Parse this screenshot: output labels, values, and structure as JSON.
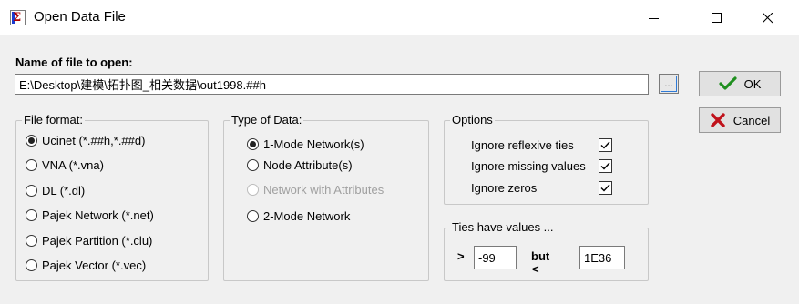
{
  "window": {
    "title": "Open Data File"
  },
  "file": {
    "label": "Name of file to open:",
    "path": "E:\\Desktop\\建模\\拓扑图_相关数据\\out1998.##h",
    "browse_label": "..."
  },
  "buttons": {
    "ok": "OK",
    "cancel": "Cancel"
  },
  "file_format": {
    "title": "File format:",
    "options": [
      "Ucinet (*.##h,*.##d)",
      "VNA (*.vna)",
      "DL (*.dl)",
      "Pajek Network (*.net)",
      "Pajek Partition (*.clu)",
      "Pajek Vector (*.vec)"
    ],
    "selected": "Ucinet (*.##h,*.##d)"
  },
  "data_type": {
    "title": "Type of Data:",
    "options": [
      "1-Mode Network(s)",
      "Node Attribute(s)",
      "Network with Attributes",
      "2-Mode Network"
    ],
    "selected": "1-Mode Network(s)",
    "disabled": [
      "Network with Attributes"
    ]
  },
  "options": {
    "title": "Options",
    "items": [
      {
        "label": "Ignore reflexive ties",
        "checked": true
      },
      {
        "label": "Ignore missing values",
        "checked": true
      },
      {
        "label": "Ignore zeros",
        "checked": true
      }
    ]
  },
  "ties": {
    "title": "Ties have values ...",
    "gt_symbol": ">",
    "min_value": "-99",
    "but_label": "but",
    "lt_symbol": "<",
    "max_value": "1E36"
  },
  "colors": {
    "ok_check": "#1f8f1f",
    "cancel_x": "#c0121b"
  }
}
